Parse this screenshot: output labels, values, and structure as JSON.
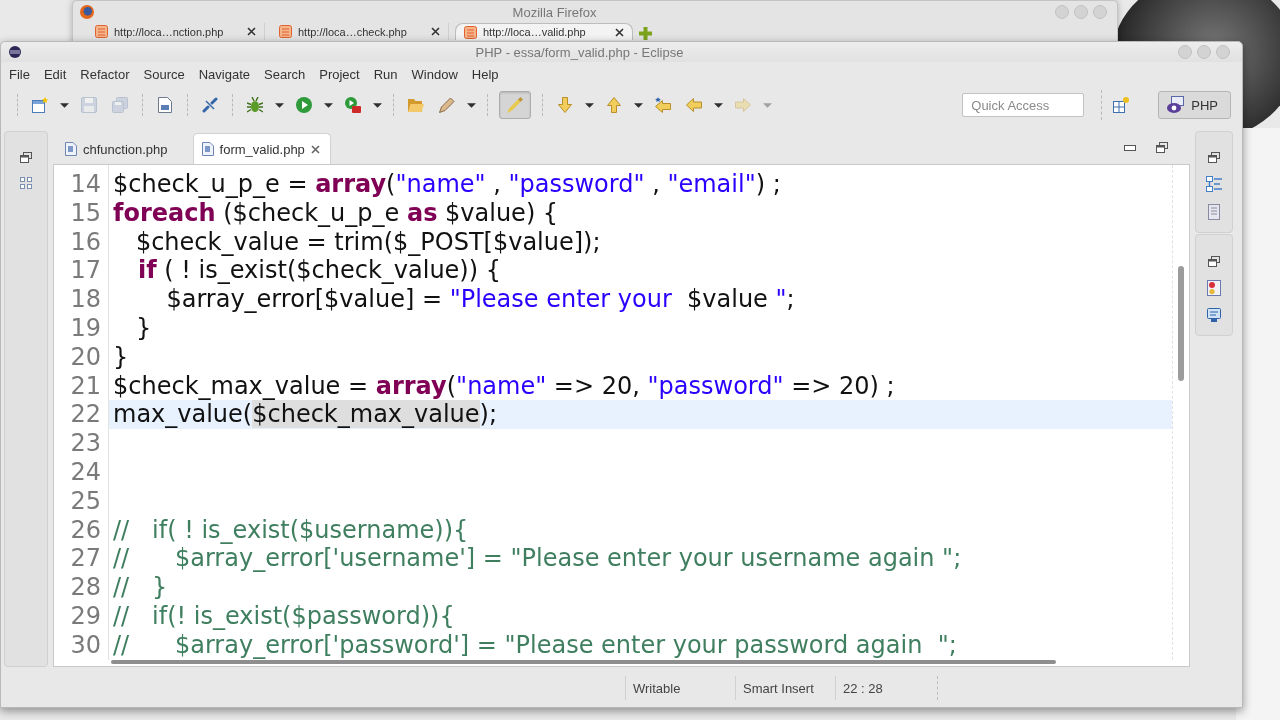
{
  "browser_window": {
    "title": "Mozilla Firefox",
    "tabs": [
      {
        "label": "http://loca…nction.php",
        "selected": false
      },
      {
        "label": "http://loca…check.php",
        "selected": false
      },
      {
        "label": "http://loca…valid.php",
        "selected": true
      }
    ]
  },
  "window": {
    "title": "PHP - essa/form_valid.php - Eclipse"
  },
  "menu": [
    "File",
    "Edit",
    "Refactor",
    "Source",
    "Navigate",
    "Search",
    "Project",
    "Run",
    "Window",
    "Help"
  ],
  "toolbar": [
    {
      "disabled": false,
      "pressed": false
    },
    {
      "disabled": true,
      "pressed": false
    },
    {
      "disabled": true,
      "pressed": false
    },
    {
      "disabled": false,
      "pressed": false
    },
    {
      "disabled": false,
      "pressed": false
    },
    {
      "disabled": false,
      "pressed": false
    },
    {
      "disabled": false,
      "pressed": false
    },
    {
      "disabled": false,
      "pressed": false
    },
    {
      "disabled": false,
      "pressed": false
    },
    {
      "disabled": false,
      "pressed": false
    },
    {
      "disabled": false,
      "pressed": true
    },
    {
      "disabled": false,
      "pressed": false
    },
    {
      "disabled": false,
      "pressed": false
    },
    {
      "disabled": false,
      "pressed": false
    },
    {
      "disabled": false,
      "pressed": false
    },
    {
      "disabled": true,
      "pressed": false
    }
  ],
  "quick_access": {
    "placeholder": "Quick Access"
  },
  "perspectives": [
    {
      "label": "PHP",
      "selected": true
    }
  ],
  "editor": {
    "tabs": [
      {
        "label": "chfunction.php",
        "selected": false
      },
      {
        "label": "form_valid.php",
        "selected": true
      }
    ],
    "lines": [
      {
        "number": "14",
        "current": false,
        "tokens": [
          {
            "kind": "plain",
            "text": "$check_u_p_e = "
          },
          {
            "kind": "keyword",
            "text": "array"
          },
          {
            "kind": "plain",
            "text": "("
          },
          {
            "kind": "string",
            "text": "\"name\""
          },
          {
            "kind": "plain",
            "text": " , "
          },
          {
            "kind": "string",
            "text": "\"password\""
          },
          {
            "kind": "plain",
            "text": " , "
          },
          {
            "kind": "string",
            "text": "\"email\""
          },
          {
            "kind": "plain",
            "text": ") ;"
          }
        ]
      },
      {
        "number": "15",
        "current": false,
        "tokens": [
          {
            "kind": "keyword",
            "text": "foreach"
          },
          {
            "kind": "plain",
            "text": " ($check_u_p_e "
          },
          {
            "kind": "keyword",
            "text": "as"
          },
          {
            "kind": "plain",
            "text": " $value) {"
          }
        ]
      },
      {
        "number": "16",
        "current": false,
        "tokens": [
          {
            "kind": "plain",
            "text": "   $check_value = trim($_POST[$value]);"
          }
        ]
      },
      {
        "number": "17",
        "current": false,
        "tokens": [
          {
            "kind": "keyword",
            "text": "   if"
          },
          {
            "kind": "plain",
            "text": " ( ! is_exist($check_value)) {"
          }
        ]
      },
      {
        "number": "18",
        "current": false,
        "tokens": [
          {
            "kind": "plain",
            "text": "       $array_error[$value] = "
          },
          {
            "kind": "string",
            "text": "\"Please enter your  "
          },
          {
            "kind": "plain",
            "text": "$value"
          },
          {
            "kind": "string",
            "text": " \""
          },
          {
            "kind": "plain",
            "text": ";"
          }
        ]
      },
      {
        "number": "19",
        "current": false,
        "tokens": [
          {
            "kind": "plain",
            "text": "   }"
          }
        ]
      },
      {
        "number": "20",
        "current": false,
        "tokens": [
          {
            "kind": "plain",
            "text": "}"
          }
        ]
      },
      {
        "number": "21",
        "current": false,
        "tokens": [
          {
            "kind": "plain",
            "text": "$check_max_value = "
          },
          {
            "kind": "keyword",
            "text": "array"
          },
          {
            "kind": "plain",
            "text": "("
          },
          {
            "kind": "string",
            "text": "\"name\""
          },
          {
            "kind": "plain",
            "text": " => 20, "
          },
          {
            "kind": "string",
            "text": "\"password\""
          },
          {
            "kind": "plain",
            "text": " => 20) ;"
          }
        ]
      },
      {
        "number": "22",
        "current": true,
        "tokens": [
          {
            "kind": "plain",
            "text": "max_value("
          },
          {
            "kind": "occurrence",
            "text": "$check_max_value"
          },
          {
            "kind": "plain",
            "text": ");"
          }
        ]
      },
      {
        "number": "23",
        "current": false
      },
      {
        "number": "24",
        "current": false
      },
      {
        "number": "25",
        "current": false
      },
      {
        "number": "26",
        "current": false,
        "tokens": [
          {
            "kind": "comment",
            "text": "//   if( ! is_exist($username)){"
          }
        ]
      },
      {
        "number": "27",
        "current": false,
        "tokens": [
          {
            "kind": "comment",
            "text": "//      $array_error['username'] = \"Please enter your username again \";"
          }
        ]
      },
      {
        "number": "28",
        "current": false,
        "tokens": [
          {
            "kind": "comment",
            "text": "//   }"
          }
        ]
      },
      {
        "number": "29",
        "current": false,
        "tokens": [
          {
            "kind": "comment",
            "text": "//   if(! is_exist($password)){"
          }
        ]
      },
      {
        "number": "30",
        "current": false,
        "tokens": [
          {
            "kind": "comment",
            "text": "//      $array_error['password'] = \"Please enter your password again  \";"
          }
        ]
      }
    ]
  },
  "status_bar": [
    "Writable",
    "Smart Insert",
    "22 : 28"
  ]
}
